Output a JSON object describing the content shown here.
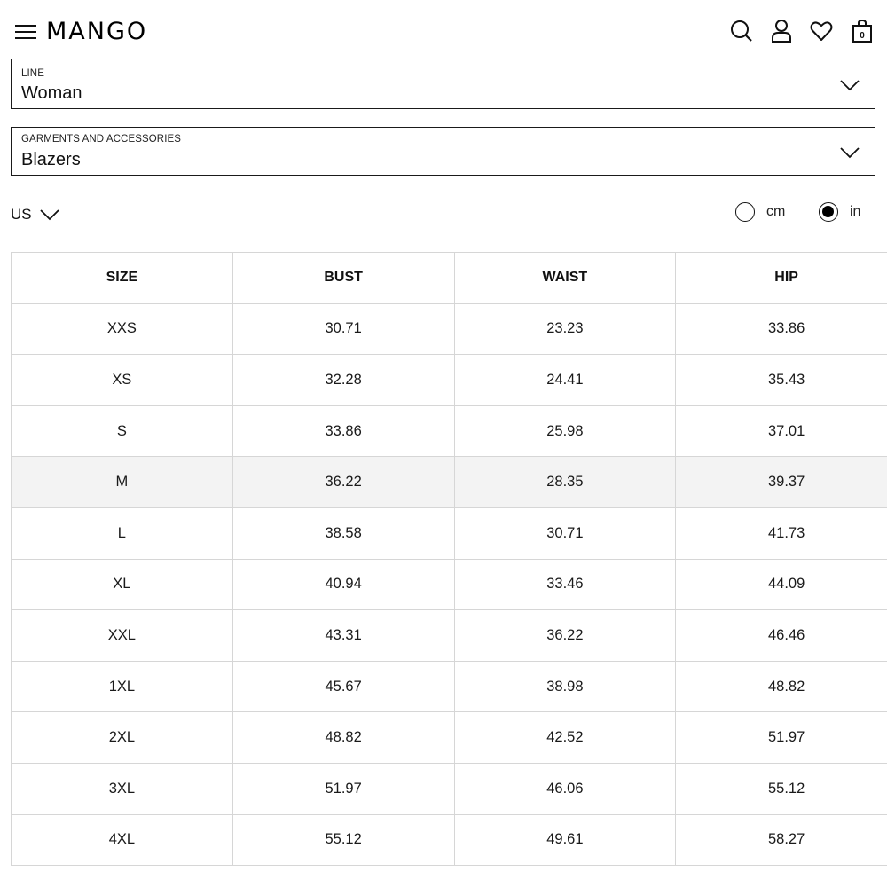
{
  "header": {
    "logo": "MANGO",
    "cart_count": "0",
    "icons": [
      "menu-icon",
      "search-icon",
      "user-icon",
      "heart-icon",
      "bag-icon"
    ]
  },
  "line_select": {
    "label": "LINE",
    "value": "Woman"
  },
  "garments_select": {
    "label": "GARMENTS AND ACCESSORIES",
    "value": "Blazers"
  },
  "unit_system": {
    "value": "US"
  },
  "units": [
    {
      "label": "cm",
      "selected": false
    },
    {
      "label": "in",
      "selected": true
    }
  ],
  "table": {
    "headers": [
      "SIZE",
      "BUST",
      "WAIST",
      "HIP"
    ],
    "highlighted_row": "M",
    "rows": [
      [
        "XXS",
        "30.71",
        "23.23",
        "33.86"
      ],
      [
        "XS",
        "32.28",
        "24.41",
        "35.43"
      ],
      [
        "S",
        "33.86",
        "25.98",
        "37.01"
      ],
      [
        "M",
        "36.22",
        "28.35",
        "39.37"
      ],
      [
        "L",
        "38.58",
        "30.71",
        "41.73"
      ],
      [
        "XL",
        "40.94",
        "33.46",
        "44.09"
      ],
      [
        "XXL",
        "43.31",
        "36.22",
        "46.46"
      ],
      [
        "1XL",
        "45.67",
        "38.98",
        "48.82"
      ],
      [
        "2XL",
        "48.82",
        "42.52",
        "51.97"
      ],
      [
        "3XL",
        "51.97",
        "46.06",
        "55.12"
      ],
      [
        "4XL",
        "55.12",
        "49.61",
        "58.27"
      ]
    ]
  }
}
